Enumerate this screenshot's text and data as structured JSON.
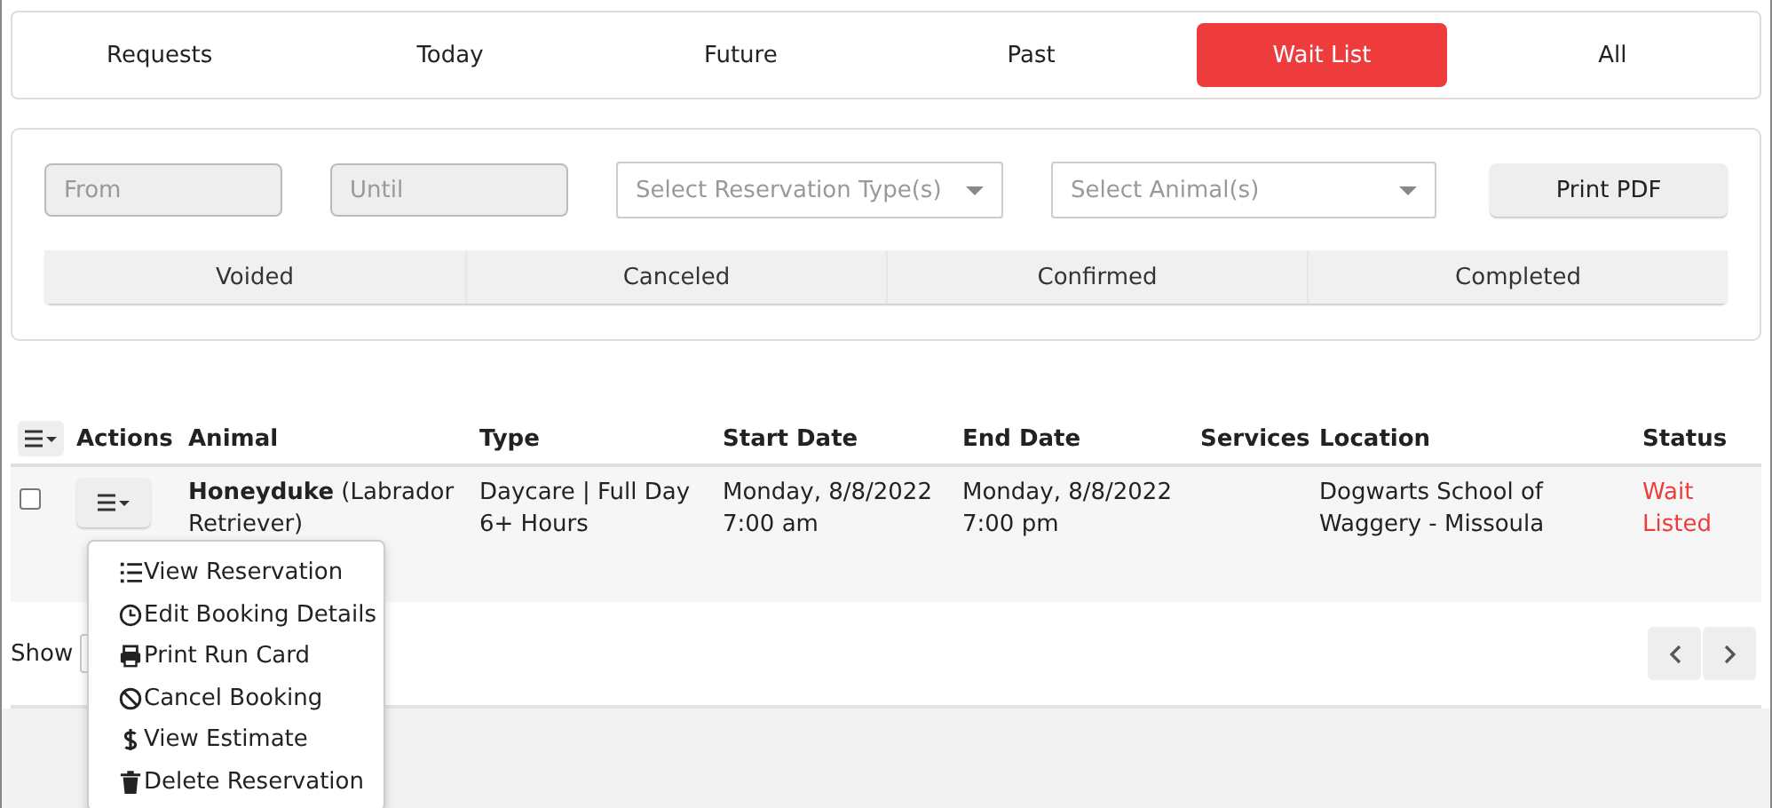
{
  "tabs": [
    {
      "label": "Requests",
      "selected": false
    },
    {
      "label": "Today",
      "selected": false
    },
    {
      "label": "Future",
      "selected": false
    },
    {
      "label": "Past",
      "selected": false
    },
    {
      "label": "Wait List",
      "selected": true
    },
    {
      "label": "All",
      "selected": false
    }
  ],
  "filters": {
    "from": {
      "placeholder": "From"
    },
    "until": {
      "placeholder": "Until"
    },
    "reservation_type": {
      "placeholder": "Select Reservation Type(s)"
    },
    "animal": {
      "placeholder": "Select Animal(s)"
    },
    "print_button": "Print PDF"
  },
  "status_buttons": [
    "Voided",
    "Canceled",
    "Confirmed",
    "Completed"
  ],
  "table": {
    "columns": [
      "Actions",
      "Animal",
      "Type",
      "Start Date",
      "End Date",
      "Services",
      "Location",
      "Status"
    ],
    "rows": [
      {
        "checked": false,
        "animal_name": "Honeyduke",
        "animal_breed": "(Labrador Retriever)",
        "type": "Daycare | Full Day 6+ Hours",
        "start_date": "Monday, 8/8/2022",
        "start_time": "7:00 am",
        "end_date": "Monday, 8/8/2022",
        "end_time": "7:00 pm",
        "services": "",
        "location": "Dogwarts School of Waggery - Missoula",
        "status": "Wait Listed"
      }
    ]
  },
  "actions_menu": [
    {
      "label": "View Reservation"
    },
    {
      "label": "Edit Booking Details"
    },
    {
      "label": "Print Run Card"
    },
    {
      "label": "Cancel Booking"
    },
    {
      "label": "View Estimate"
    },
    {
      "label": "Delete Reservation"
    }
  ],
  "footer": {
    "show_label": "Show"
  }
}
